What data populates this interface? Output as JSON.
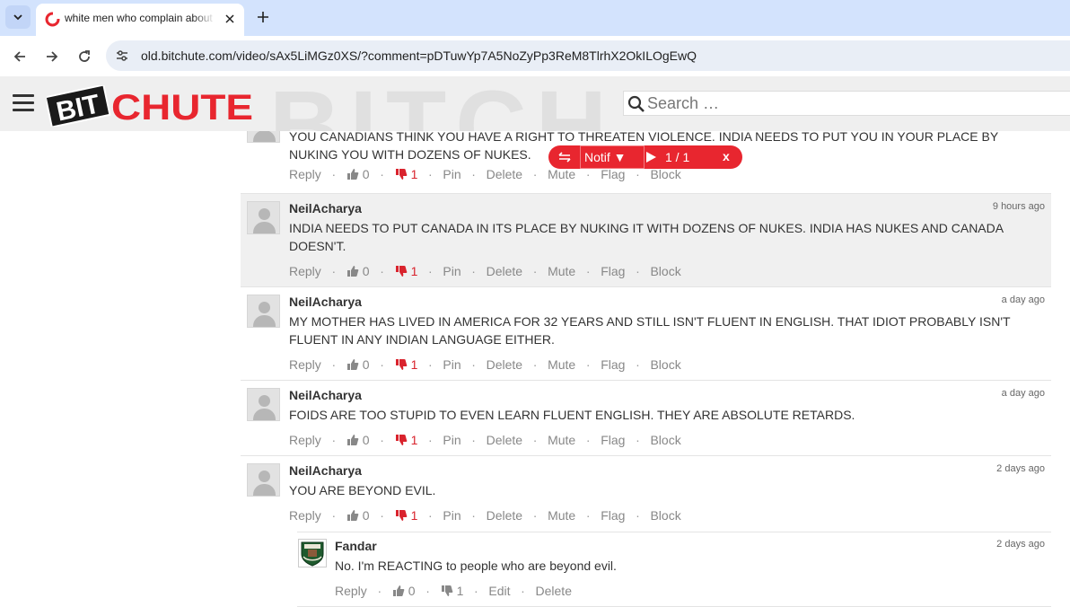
{
  "browser": {
    "tab_title": "white men who complain about",
    "url": "old.bitchute.com/video/sAx5LiMGz0XS/?comment=pDTuwYp7A5NoZyPp3ReM8TlrhX2OkILOgEwQ"
  },
  "site": {
    "logo_text_left": "BIT",
    "logo_text_right": "CHUTE",
    "watermark": "BITCH",
    "search_placeholder": "Search …"
  },
  "notif": {
    "dropdown_label": "Notif ▼",
    "count": "1 / 1",
    "close_label": "x"
  },
  "action_labels": {
    "reply": "Reply",
    "pin": "Pin",
    "delete": "Delete",
    "mute": "Mute",
    "flag": "Flag",
    "block": "Block",
    "edit": "Edit",
    "separator": "·"
  },
  "comments": [
    {
      "username": "",
      "timestamp": "",
      "text": "YOU CANADIANS THINK YOU HAVE A RIGHT TO THREATEN VIOLENCE. INDIA NEEDS TO PUT YOU IN YOUR PLACE BY NUKING YOU WITH DOZENS OF NUKES.",
      "likes": "0",
      "dislikes": "1"
    },
    {
      "username": "NeilAcharya",
      "timestamp": "9 hours ago",
      "text": "INDIA NEEDS TO PUT CANADA IN ITS PLACE BY NUKING IT WITH DOZENS OF NUKES. INDIA HAS NUKES AND CANADA DOESN'T.",
      "likes": "0",
      "dislikes": "1"
    },
    {
      "username": "NeilAcharya",
      "timestamp": "a day ago",
      "text": "MY MOTHER HAS LIVED IN AMERICA FOR 32 YEARS AND STILL ISN'T FLUENT IN ENGLISH. THAT IDIOT PROBABLY ISN'T FLUENT IN ANY INDIAN LANGUAGE EITHER.",
      "likes": "0",
      "dislikes": "1"
    },
    {
      "username": "NeilAcharya",
      "timestamp": "a day ago",
      "text": "FOIDS ARE TOO STUPID TO EVEN LEARN FLUENT ENGLISH. THEY ARE ABSOLUTE RETARDS.",
      "likes": "0",
      "dislikes": "1"
    },
    {
      "username": "NeilAcharya",
      "timestamp": "2 days ago",
      "text": "YOU ARE BEYOND EVIL.",
      "likes": "0",
      "dislikes": "1"
    }
  ],
  "reply": {
    "username": "Fandar",
    "timestamp": "2 days ago",
    "text": "No. I'm REACTING to people who are beyond evil.",
    "likes": "0",
    "dislikes": "1"
  },
  "colors": {
    "brand_red": "#e8262f",
    "highlight_bg": "#f0f0f0"
  }
}
